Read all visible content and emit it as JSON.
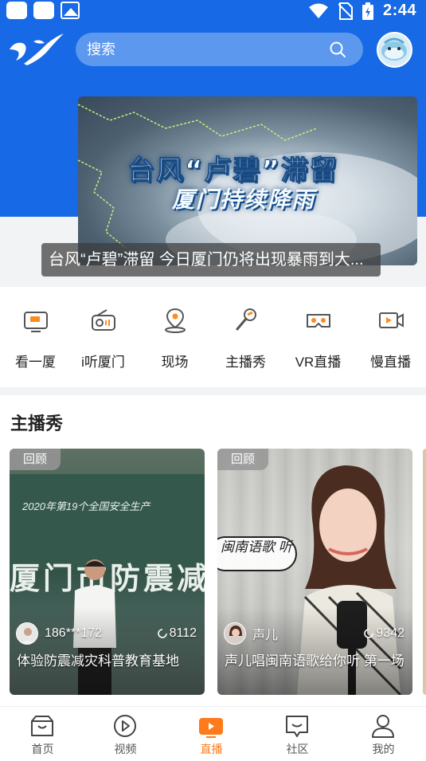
{
  "status_bar": {
    "time": "2:44"
  },
  "header": {
    "search": {
      "placeholder": "搜索"
    }
  },
  "banner": {
    "image_line1": "台风“卢碧”滞留",
    "image_line2": "厦门持续降雨",
    "caption": "台风“卢碧”滞留 今日厦门仍将出现暴雨到大..."
  },
  "categories": [
    {
      "label": "看一厦",
      "icon": "tv-icon"
    },
    {
      "label": "i听厦门",
      "icon": "radio-icon"
    },
    {
      "label": "现场",
      "icon": "location-pin-icon"
    },
    {
      "label": "主播秀",
      "icon": "microphone-icon"
    },
    {
      "label": "VR直播",
      "icon": "vr-headset-icon"
    },
    {
      "label": "慢直播",
      "icon": "video-camera-icon"
    }
  ],
  "section": {
    "title": "主播秀",
    "cards": [
      {
        "badge": "回顾",
        "user": "186***172",
        "views": "8112",
        "title": "体验防震减灾科普教育基地",
        "board_text": "2020年第19个全国安全生产",
        "sign_text": "厦门市防震减灾"
      },
      {
        "badge": "回顾",
        "user": "声儿",
        "views": "9342",
        "title": "声儿唱闽南语歌给你听 第一场",
        "bubble_text": "闽南语歌 听"
      }
    ]
  },
  "bottom_nav": [
    {
      "label": "首页",
      "icon": "home-bag-icon"
    },
    {
      "label": "视频",
      "icon": "video-play-icon"
    },
    {
      "label": "直播",
      "icon": "live-tv-icon",
      "active": true
    },
    {
      "label": "社区",
      "icon": "community-chat-icon"
    },
    {
      "label": "我的",
      "icon": "profile-icon"
    }
  ],
  "colors": {
    "brand_blue": "#1769e6",
    "active_orange": "#ff7a1a"
  }
}
